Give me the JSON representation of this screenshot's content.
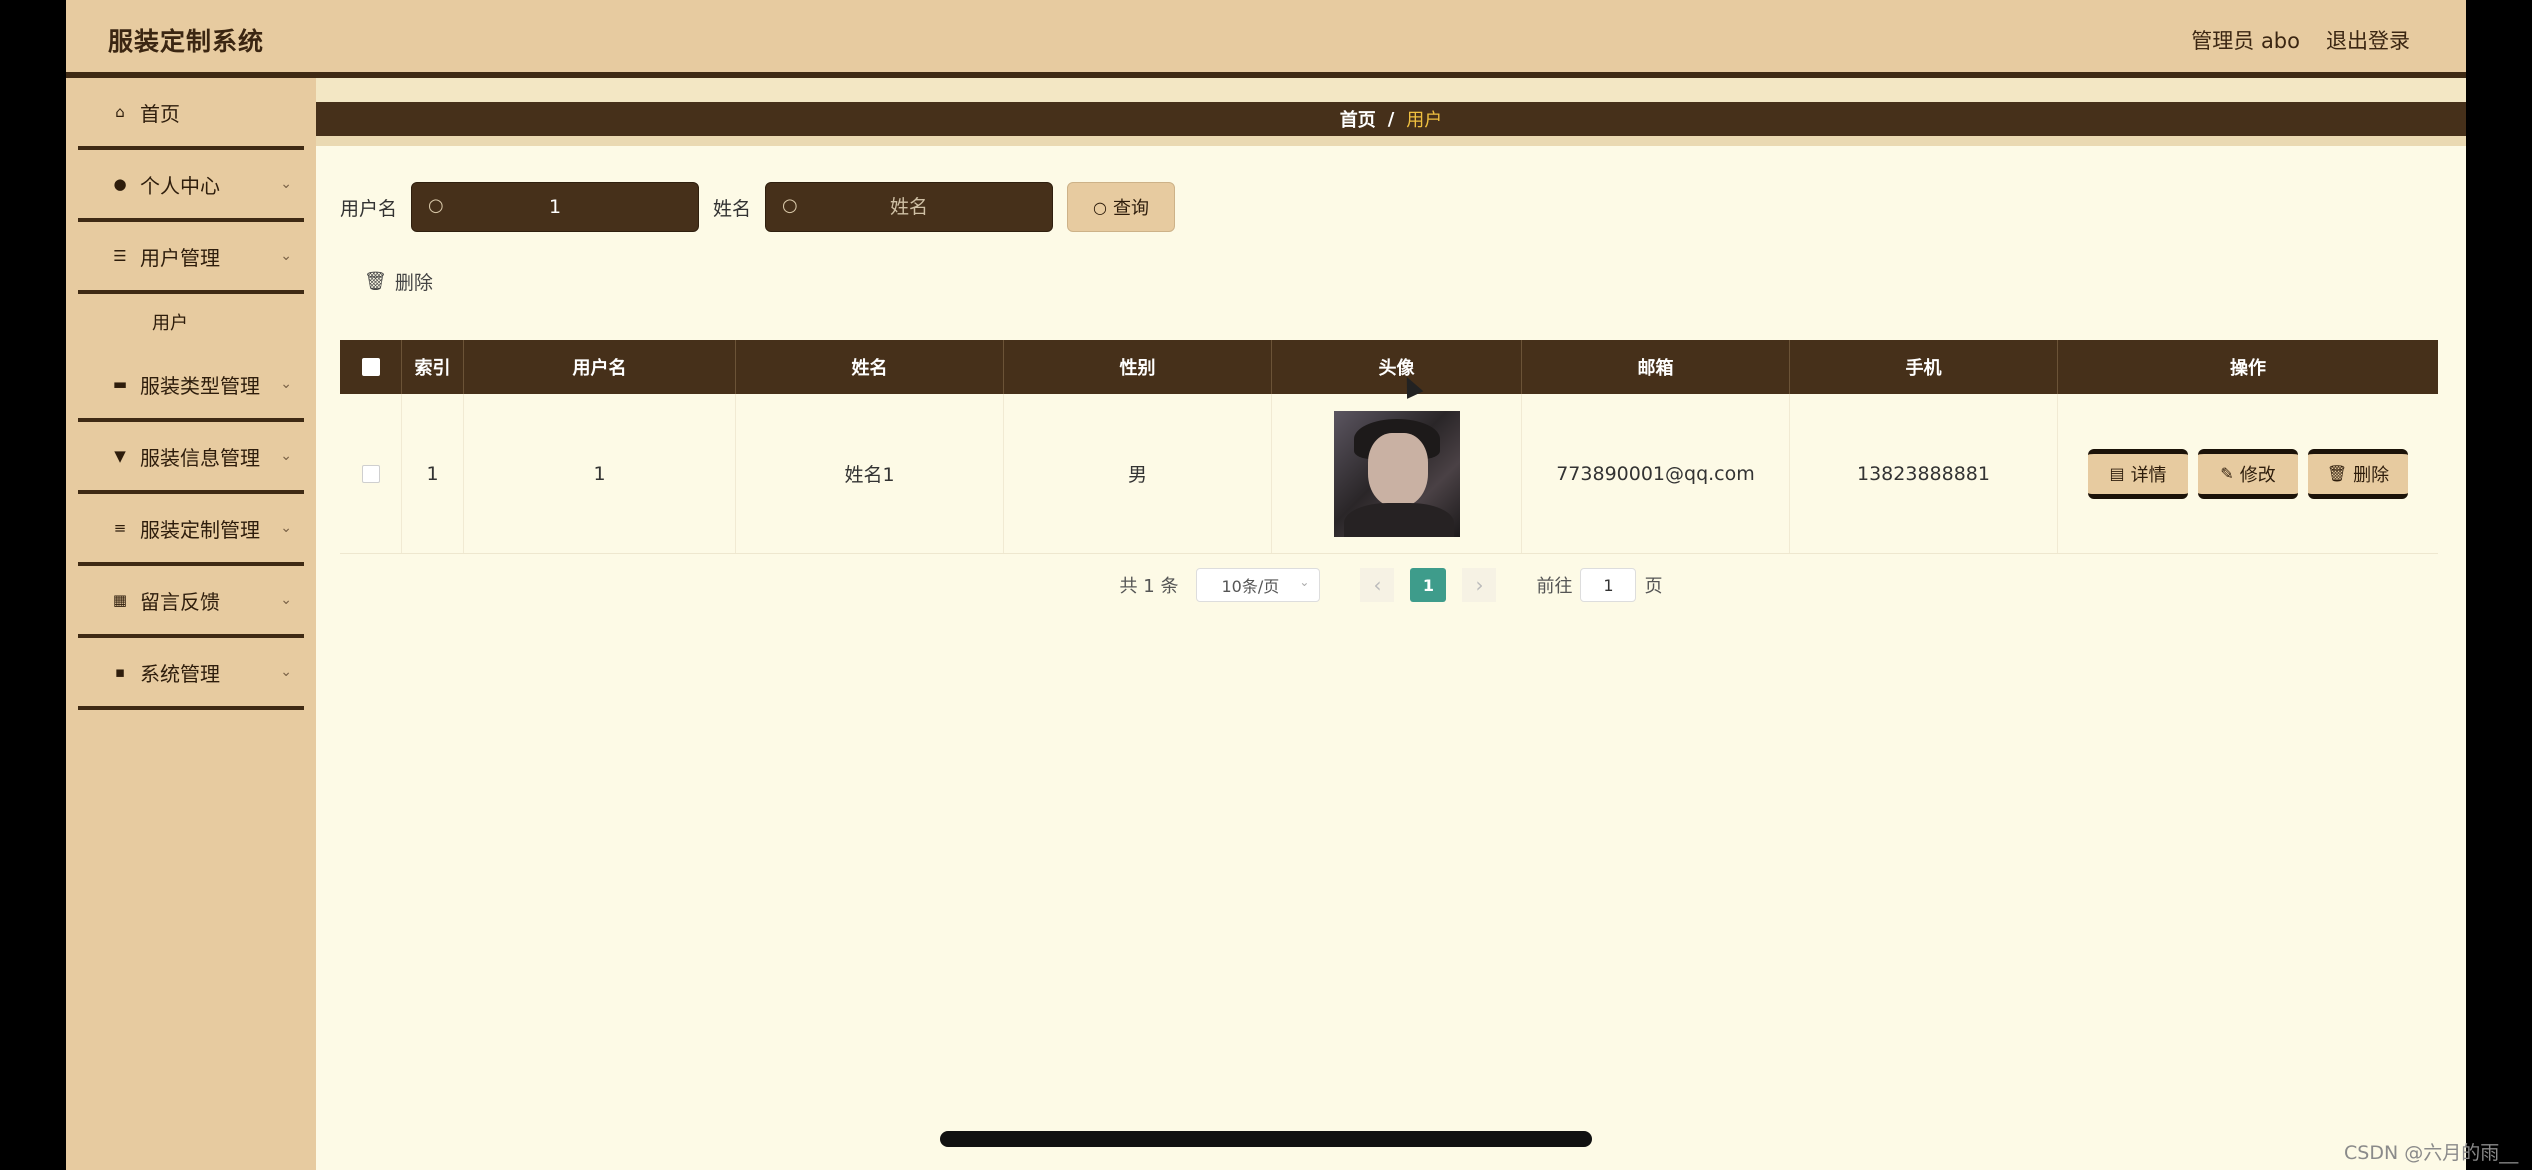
{
  "app": {
    "title": "服装定制系统",
    "user_label": "管理员 abo",
    "logout_label": "退出登录"
  },
  "sidebar": {
    "items": [
      {
        "label": "首页",
        "icon": "home-icon",
        "glyph": "⌂"
      },
      {
        "label": "个人中心",
        "icon": "user-icon",
        "glyph": "●"
      },
      {
        "label": "用户管理",
        "icon": "sliders-icon",
        "glyph": "☰"
      },
      {
        "label": "服装类型管理",
        "icon": "briefcase-icon",
        "glyph": "▬"
      },
      {
        "label": "服装信息管理",
        "icon": "tag-icon",
        "glyph": "▼"
      },
      {
        "label": "服装定制管理",
        "icon": "list-icon",
        "glyph": "≡"
      },
      {
        "label": "留言反馈",
        "icon": "grid-icon",
        "glyph": "▦"
      },
      {
        "label": "系统管理",
        "icon": "apps-icon",
        "glyph": "▪"
      }
    ],
    "sub_items": [
      {
        "label": "用户"
      }
    ]
  },
  "breadcrumb": {
    "home": "首页",
    "separator": "/",
    "current": "用户"
  },
  "search": {
    "username_label": "用户名",
    "username_value": "1",
    "name_label": "姓名",
    "name_placeholder": "姓名",
    "query_label": "查询"
  },
  "toolbar": {
    "delete_label": "删除"
  },
  "table": {
    "headers": [
      "索引",
      "用户名",
      "姓名",
      "性别",
      "头像",
      "邮箱",
      "手机",
      "操作"
    ],
    "rows": [
      {
        "index": "1",
        "username": "1",
        "name": "姓名1",
        "gender": "男",
        "email": "773890001@qq.com",
        "phone": "13823888881"
      }
    ],
    "actions": {
      "detail": "详情",
      "edit": "修改",
      "delete": "删除"
    }
  },
  "pagination": {
    "total": "共 1 条",
    "page_size": "10条/页",
    "current_page": "1",
    "goto_label": "前往",
    "goto_value": "1",
    "page_suffix": "页"
  },
  "watermark": "CSDN @六月的雨__",
  "colors": {
    "primary_dark": "#46301a",
    "accent_tan": "#e7cba0",
    "background": "#fdfae6",
    "active_page": "#3e9c8b"
  }
}
